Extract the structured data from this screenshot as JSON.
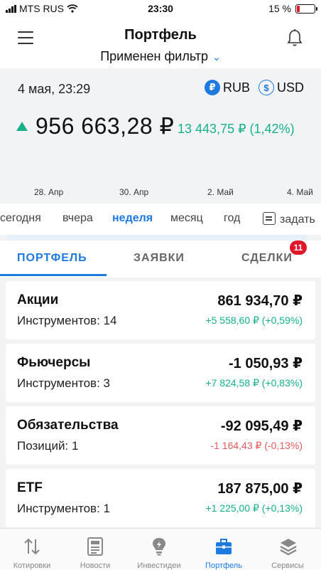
{
  "status_bar": {
    "carrier": "MTS RUS",
    "time": "23:30",
    "battery": "15 %"
  },
  "header": {
    "title": "Портфель",
    "filter": "Применен фильтр"
  },
  "summary": {
    "date": "4 мая, 23:29",
    "currency_rub": "RUB",
    "currency_usd": "USD",
    "total": "956 663,28 ₽",
    "change": "13 443,75 ₽ (1,42%)",
    "axis": [
      "28. Апр",
      "30. Апр",
      "2. Май",
      "4. Май"
    ]
  },
  "periods": [
    "сегодня",
    "вчера",
    "неделя",
    "месяц",
    "год",
    "задать"
  ],
  "tabs": {
    "portfolio": "ПОРТФЕЛЬ",
    "orders": "ЗАЯВКИ",
    "deals": "СДЕЛКИ",
    "deals_badge": "11"
  },
  "cards": [
    {
      "name": "Акции",
      "sub": "Инструментов: 14",
      "value": "861 934,70 ₽",
      "delta": "+5 558,60 ₽ (+0,59%)"
    },
    {
      "name": "Фьючерсы",
      "sub": "Инструментов: 3",
      "value": "-1 050,93 ₽",
      "delta": "+7 824,58 ₽ (+0,83%)"
    },
    {
      "name": "Обязательства",
      "sub": "Позиций: 1",
      "value": "-92 095,49 ₽",
      "delta": "-1 164,43 ₽ (-0,13%)"
    },
    {
      "name": "ETF",
      "sub": "Инструментов: 1",
      "value": "187 875,00 ₽",
      "delta": "+1 225,00 ₽ (+0,13%)"
    }
  ],
  "nav": [
    "Котировки",
    "Новости",
    "Инвестидеи",
    "Портфель",
    "Сервисы"
  ],
  "colors": {
    "accent": "#1f7ae0",
    "positive": "#16b18a",
    "negative": "#e85a5a",
    "badge": "#e0162b"
  }
}
